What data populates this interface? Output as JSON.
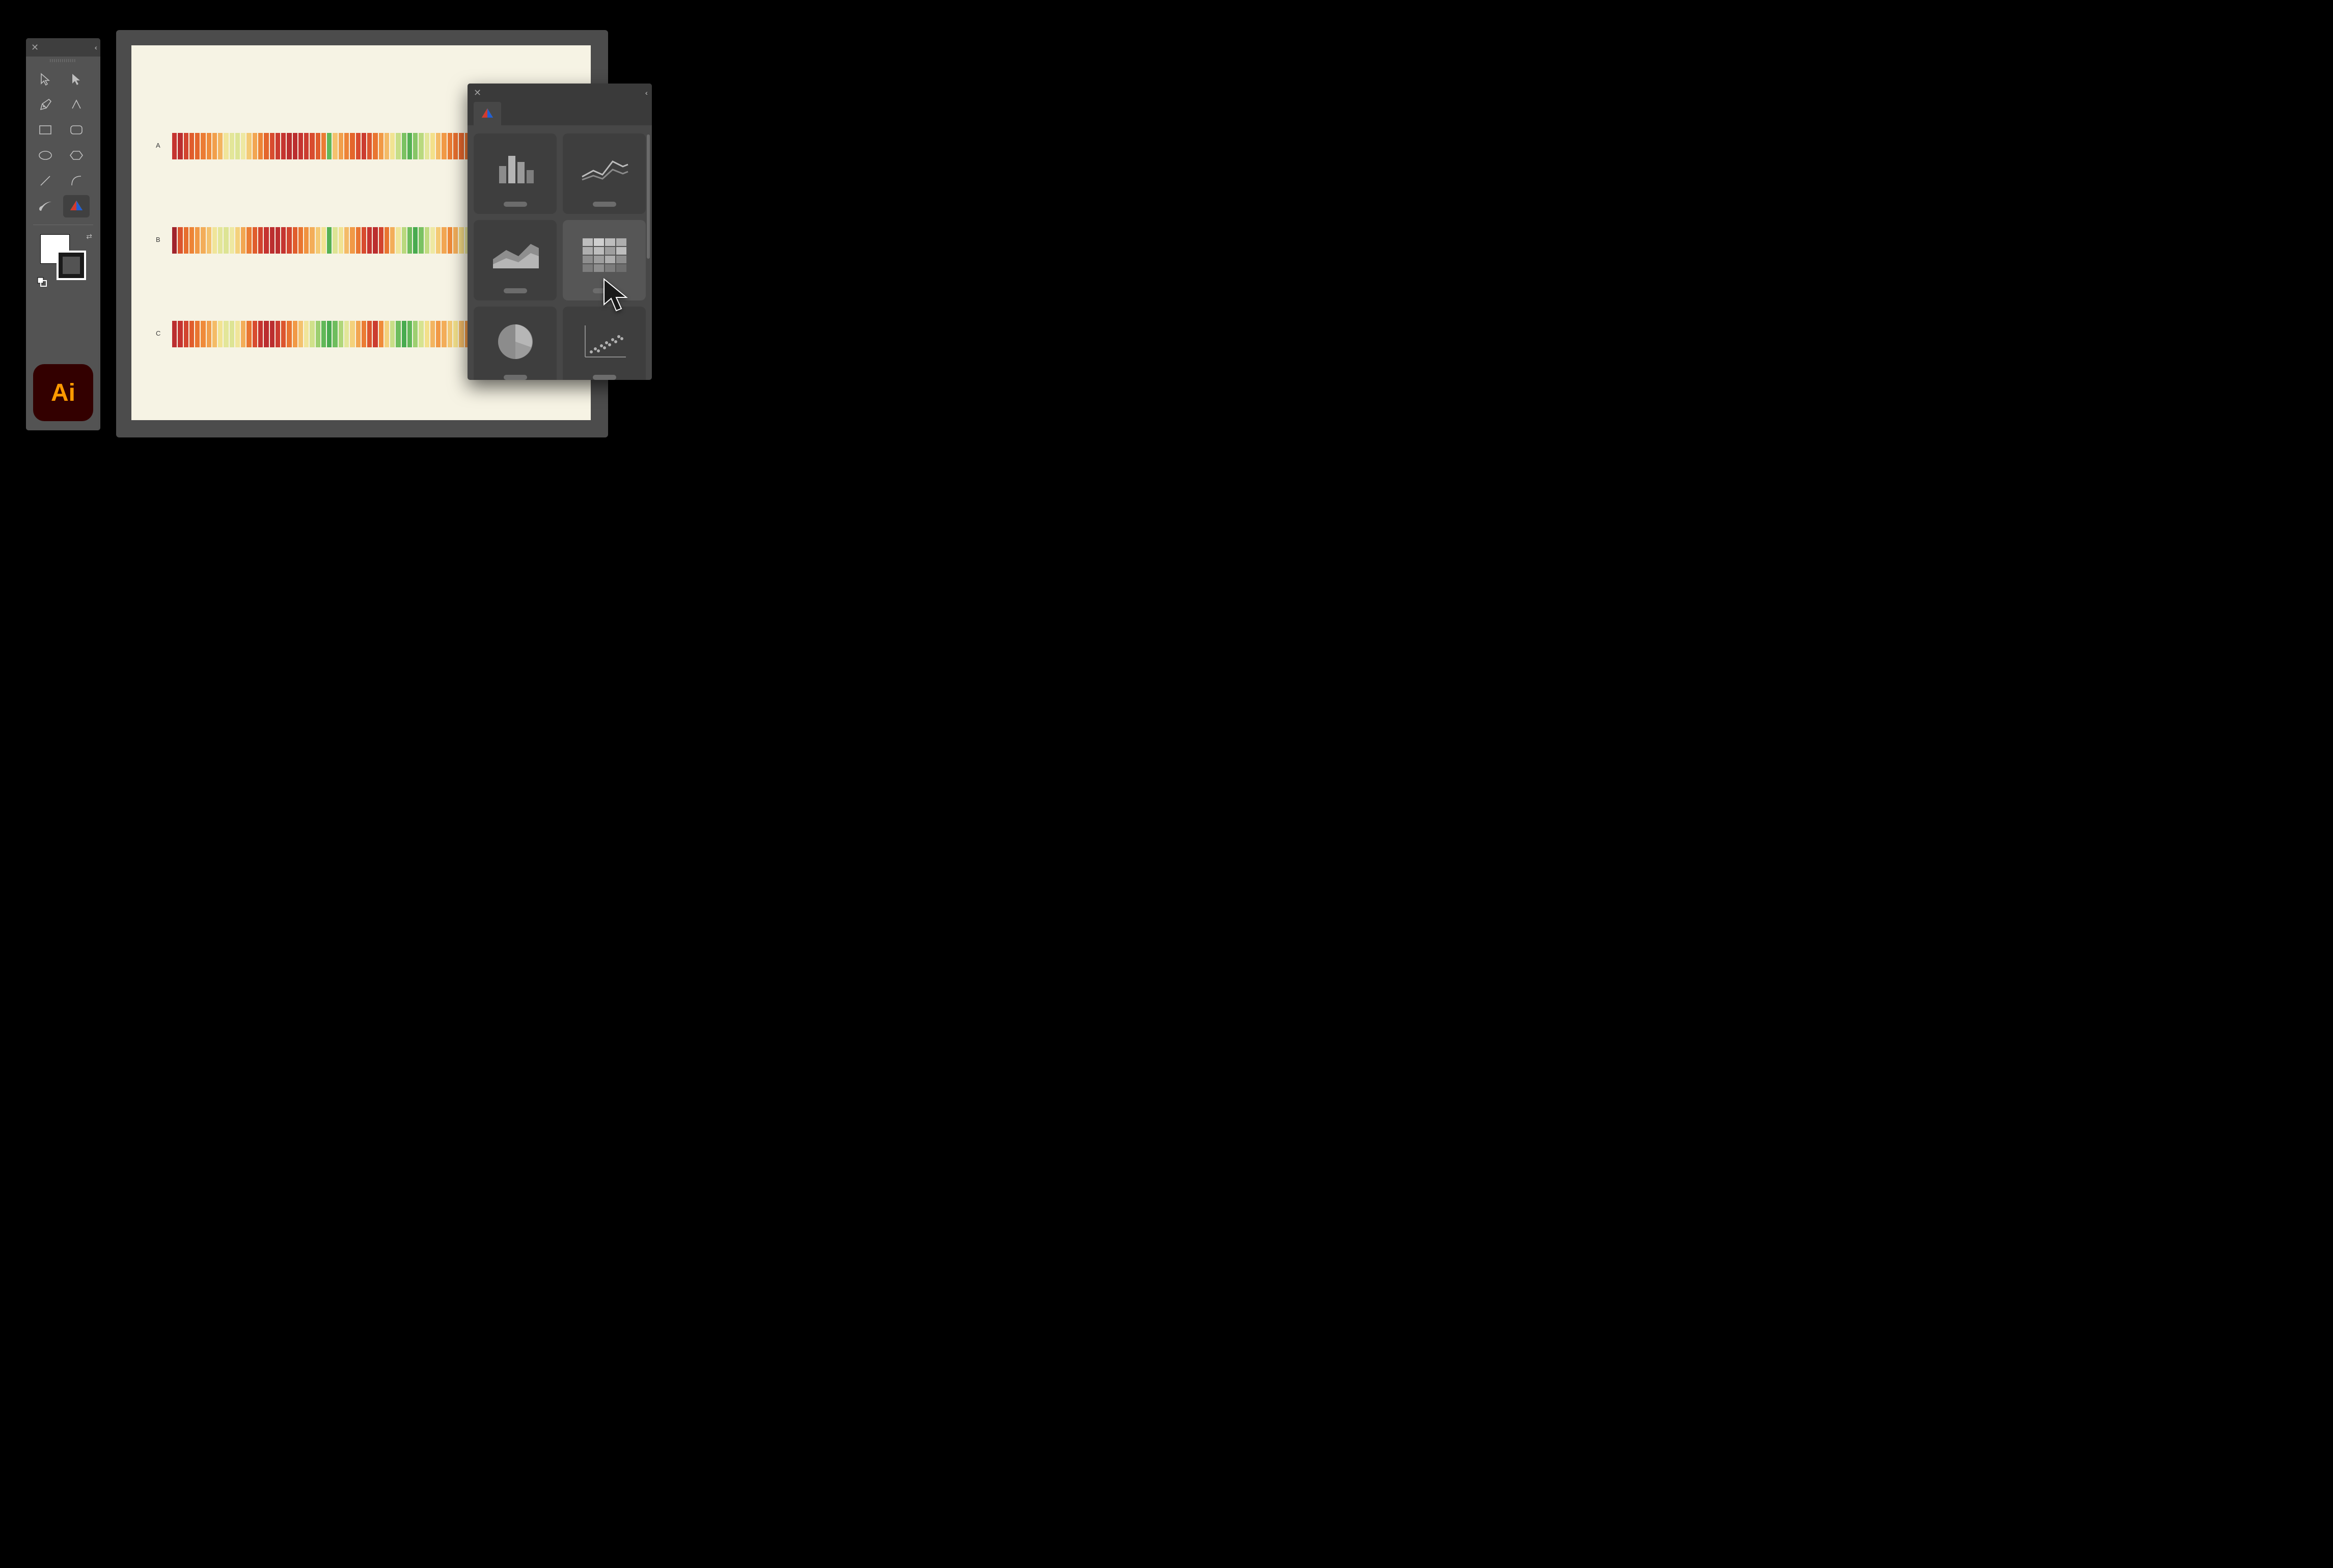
{
  "app": {
    "name": "Adobe Illustrator",
    "badge": "Ai"
  },
  "toolsPanel": {
    "closeGlyph": "✕",
    "collapseGlyph": "‹‹"
  },
  "chooserPanel": {
    "closeGlyph": "✕",
    "collapseGlyph": "‹‹",
    "types": [
      {
        "id": "bar",
        "label": "Bar"
      },
      {
        "id": "line",
        "label": "Line"
      },
      {
        "id": "area",
        "label": "Area"
      },
      {
        "id": "heatmap",
        "label": "Heatmap",
        "hover": true
      },
      {
        "id": "pie",
        "label": "Pie"
      },
      {
        "id": "scatter",
        "label": "Scatter"
      }
    ]
  },
  "palette": {
    "r0": "#931f2b",
    "r1": "#c23030",
    "r2": "#d84c2f",
    "r3": "#e66a2c",
    "o1": "#ef8b3a",
    "o2": "#f2a652",
    "o3": "#f4c26e",
    "y1": "#f3e08a",
    "y2": "#eee8a2",
    "g1": "#d7e38f",
    "g2": "#b9d97e",
    "g3": "#93cb6b",
    "g4": "#61b858",
    "g5": "#2e9d45"
  },
  "chart_data": {
    "type": "heatmap",
    "note": "Three 1-row heatmap strips (≈52 cells each). Values 0–100; 0=red, 50=yellow, 100=green.",
    "rows": [
      {
        "label": "A",
        "values": [
          8,
          6,
          12,
          18,
          20,
          26,
          30,
          36,
          42,
          58,
          64,
          66,
          60,
          48,
          38,
          28,
          20,
          14,
          10,
          8,
          6,
          6,
          8,
          10,
          14,
          18,
          26,
          92,
          46,
          36,
          28,
          20,
          14,
          10,
          16,
          24,
          34,
          44,
          56,
          72,
          88,
          94,
          86,
          76,
          64,
          54,
          44,
          34,
          26,
          22,
          20,
          24
        ]
      },
      {
        "label": "B",
        "values": [
          2,
          16,
          22,
          28,
          34,
          40,
          46,
          58,
          64,
          66,
          60,
          50,
          38,
          26,
          18,
          12,
          8,
          6,
          6,
          8,
          12,
          18,
          24,
          32,
          40,
          48,
          56,
          94,
          66,
          56,
          44,
          34,
          24,
          14,
          8,
          6,
          12,
          24,
          40,
          58,
          76,
          90,
          96,
          88,
          74,
          60,
          48,
          38,
          30,
          40,
          52,
          62
        ]
      },
      {
        "label": "C",
        "values": [
          6,
          8,
          12,
          18,
          24,
          30,
          36,
          44,
          56,
          64,
          66,
          58,
          40,
          24,
          14,
          8,
          6,
          6,
          10,
          16,
          24,
          34,
          46,
          58,
          70,
          82,
          92,
          96,
          90,
          78,
          64,
          50,
          38,
          26,
          16,
          10,
          30,
          50,
          72,
          90,
          96,
          92,
          82,
          68,
          54,
          42,
          34,
          40,
          48,
          54,
          44,
          34
        ]
      }
    ]
  }
}
